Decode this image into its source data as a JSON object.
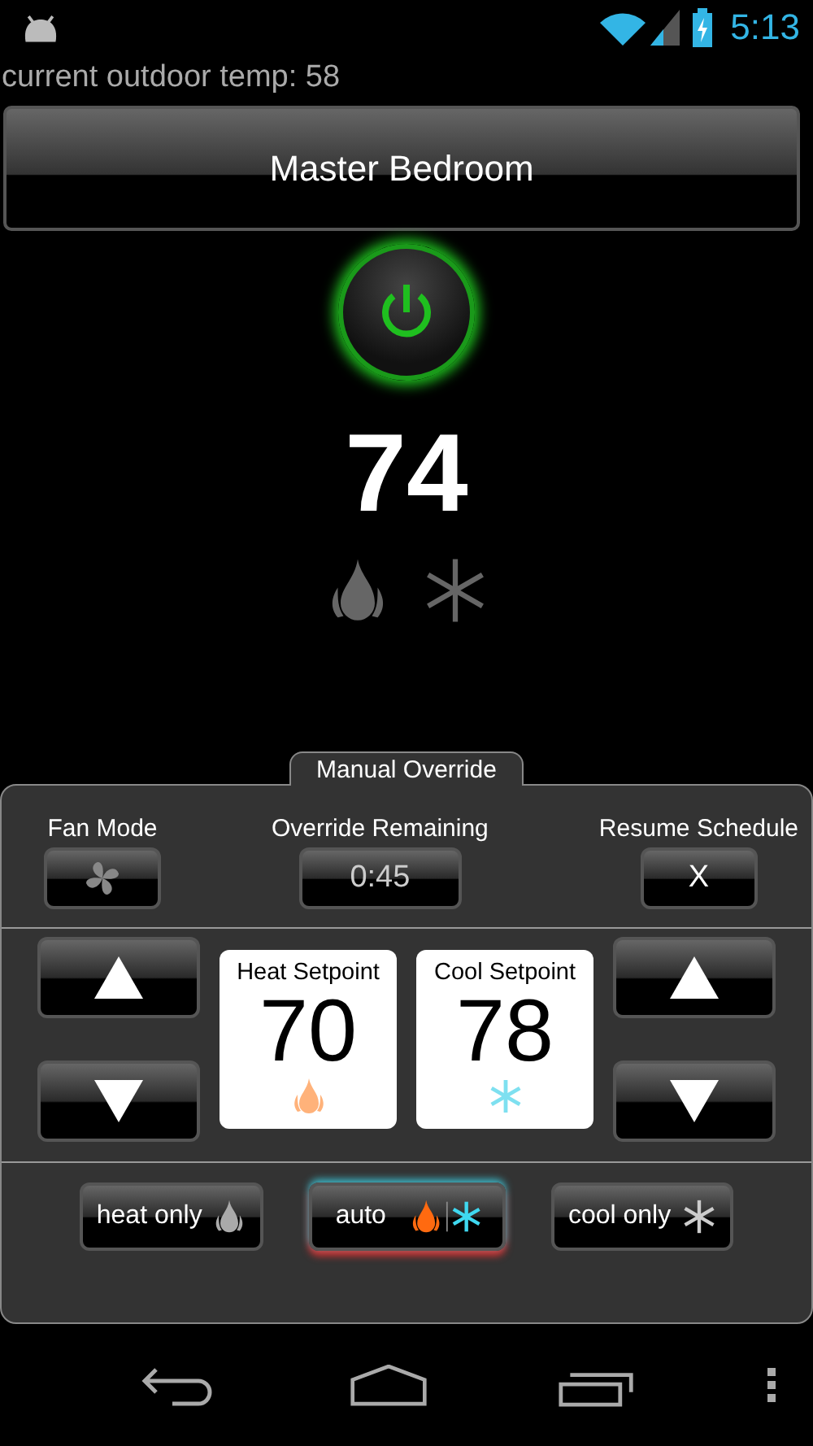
{
  "status_bar": {
    "time": "5:13"
  },
  "outdoor_temp": "current outdoor temp: 58",
  "room": "Master Bedroom",
  "power": {
    "on": true
  },
  "current_temp": "74",
  "indicators": [
    {
      "kind": "heat",
      "active": false
    },
    {
      "kind": "cool",
      "active": false
    }
  ],
  "panel": {
    "title": "Manual Override",
    "controls": [
      {
        "label": "Fan Mode",
        "kind": "fan"
      },
      {
        "label": "Override Remaining",
        "kind": "text",
        "value": "0:45"
      },
      {
        "label": "Resume Schedule",
        "kind": "text",
        "value": "X"
      }
    ],
    "setpoints": [
      {
        "kind": "heat",
        "label": "Heat Setpoint",
        "value": "70"
      },
      {
        "kind": "cool",
        "label": "Cool Setpoint",
        "value": "78"
      }
    ],
    "modes": [
      {
        "kind": "heat",
        "label": "heat only",
        "selected": false
      },
      {
        "kind": "auto",
        "label": "auto",
        "selected": true
      },
      {
        "kind": "cool",
        "label": "cool only",
        "selected": false
      }
    ]
  }
}
